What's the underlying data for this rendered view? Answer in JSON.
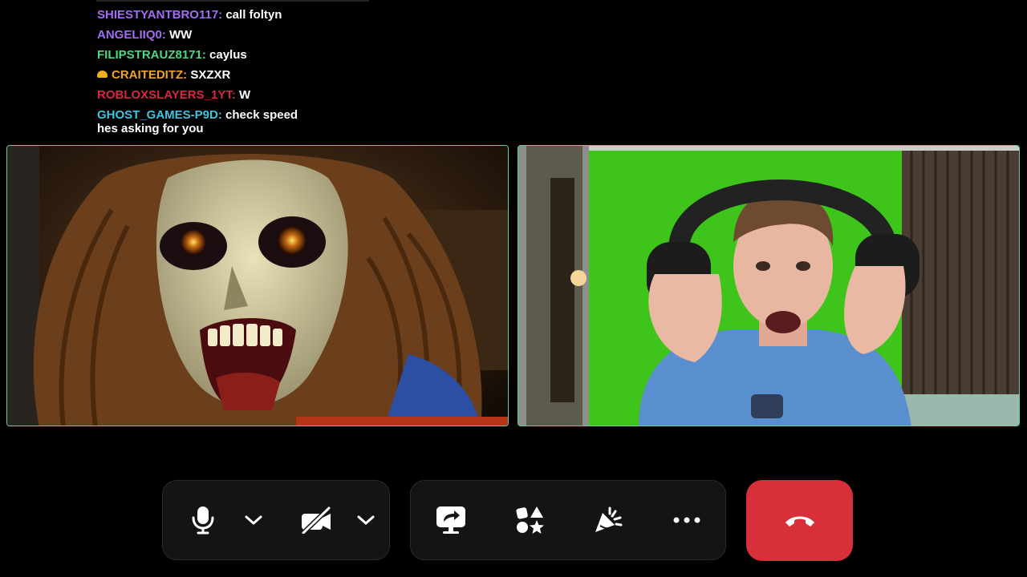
{
  "chat": {
    "messages": [
      {
        "user": "SHIESTYANTBRO117:",
        "text": "call foltyn",
        "color": "#a36cf2",
        "badge": false
      },
      {
        "user": "ANGELIIQ0:",
        "text": "WW",
        "color": "#a36cf2",
        "badge": false
      },
      {
        "user": "FILIPSTRAUZ8171:",
        "text": "caylus",
        "color": "#4ed882",
        "badge": false
      },
      {
        "user": "CRAITEDITZ:",
        "text": "SXZXR",
        "color": "#f0a230",
        "badge": true
      },
      {
        "user": "ROBLOXSLAYERS_1YT:",
        "text": "W",
        "color": "#d9263f",
        "badge": false
      },
      {
        "user": "GHOST_GAMES-P9D:",
        "text": "check speed",
        "text2": "hes asking for you",
        "color": "#3dc4e0",
        "badge": false
      }
    ]
  },
  "tiles": {
    "left_icon": "monster-face-video",
    "right_icon": "green-screen-person-video"
  },
  "controls": {
    "mic_icon": "microphone-icon",
    "mic_options_icon": "chevron-down-icon",
    "camera_icon": "camera-off-icon",
    "camera_options_icon": "chevron-down-icon",
    "share_icon": "screen-share-icon",
    "activities_icon": "activities-icon",
    "soundboard_icon": "soundboard-icon",
    "more_icon": "more-options-icon",
    "end_call_icon": "hang-up-icon"
  },
  "colors": {
    "tile_border": "#5fd39a",
    "hangup": "#d8303a",
    "control_bg": "#141414"
  }
}
